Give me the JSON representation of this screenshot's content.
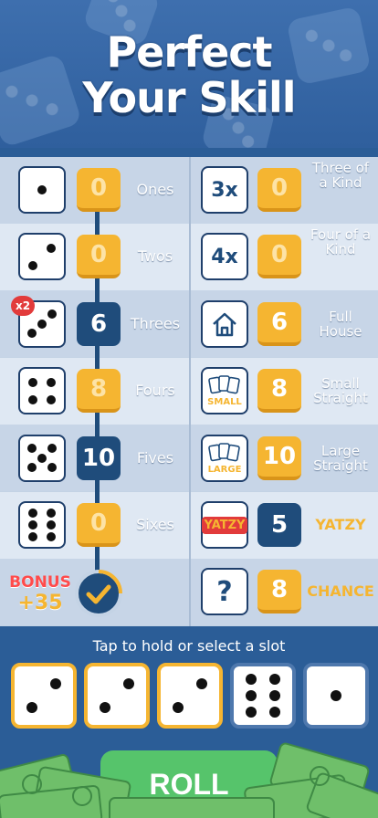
{
  "title": {
    "line1": "Perfect",
    "line2": "Your Skill"
  },
  "upper": [
    {
      "label": "Ones",
      "dice": 1,
      "score": "0",
      "state": "open"
    },
    {
      "label": "Twos",
      "dice": 2,
      "score": "0",
      "state": "open"
    },
    {
      "label": "Threes",
      "dice": 3,
      "score": "6",
      "state": "done"
    },
    {
      "label": "Fours",
      "dice": 4,
      "score": "8",
      "state": "open"
    },
    {
      "label": "Fives",
      "dice": 5,
      "score": "10",
      "state": "done"
    },
    {
      "label": "Sixes",
      "dice": 6,
      "score": "0",
      "state": "open"
    }
  ],
  "lower": [
    {
      "label": "Three of a Kind",
      "icon": "3x",
      "score": "0",
      "state": "open"
    },
    {
      "label": "Four of a Kind",
      "icon": "4x",
      "score": "0",
      "state": "open"
    },
    {
      "label": "Full House",
      "icon": "house-icon",
      "score": "6",
      "state": "open"
    },
    {
      "label": "Small Straight",
      "icon": "small-straight-icon",
      "icon_text": "SMALL",
      "score": "8",
      "state": "open"
    },
    {
      "label": "Large Straight",
      "icon": "large-straight-icon",
      "icon_text": "LARGE",
      "score": "10",
      "state": "open"
    },
    {
      "label": "YATZY",
      "icon": "yatzy-logo",
      "icon_text": "YATZY",
      "score": "5",
      "state": "done"
    },
    {
      "label": "CHANCE",
      "icon": "?",
      "score": "8",
      "state": "open"
    }
  ],
  "multiplier_badge": "x2",
  "bonus": {
    "line1": "BONUS",
    "line2": "+35"
  },
  "hint": "Tap to hold or select a slot",
  "hold_dice": [
    {
      "value": 2,
      "held": true
    },
    {
      "value": 2,
      "held": true
    },
    {
      "value": 2,
      "held": true
    },
    {
      "value": 6,
      "held": false
    },
    {
      "value": 1,
      "held": false
    }
  ],
  "roll_button": "ROLL",
  "colors": {
    "accent": "#f5b531",
    "navy": "#1f4c7b",
    "bonus_red": "#ff4b4b"
  }
}
